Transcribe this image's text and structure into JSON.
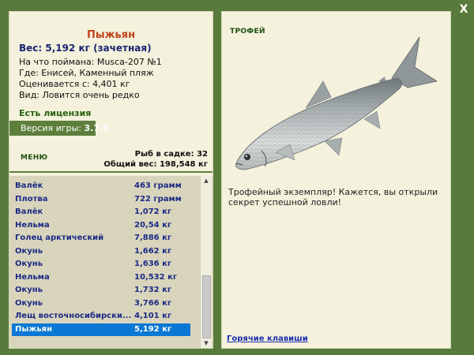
{
  "window": {
    "close_label": "X"
  },
  "fish": {
    "name": "Пыжьян",
    "weight_line": "Вес: 5,192 кг (зачетная)",
    "caught_on": "На что поймана: Musca-207 №1",
    "location": "Где: Енисей, Каменный пляж",
    "value": "Оценивается с: 4,401 кг",
    "species_note": "Вид: Ловится очень редко"
  },
  "license": "Есть лицензия",
  "version": {
    "label": "Версия игры:",
    "value": "3.7.6"
  },
  "menu_label": "МЕНЮ",
  "stats": {
    "fish_in_keepnet": "Рыб в садке: 32",
    "total_weight": "Общий вес: 198,548 кг"
  },
  "catch_list": [
    {
      "name": "Валёк",
      "weight": "463 грамм"
    },
    {
      "name": "Плотва",
      "weight": "722 грамм"
    },
    {
      "name": "Валёк",
      "weight": "1,072 кг"
    },
    {
      "name": "Нельма",
      "weight": "20,54 кг"
    },
    {
      "name": "Голец арктический",
      "weight": "7,886 кг"
    },
    {
      "name": "Окунь",
      "weight": "1,662 кг"
    },
    {
      "name": "Окунь",
      "weight": "1,636 кг"
    },
    {
      "name": "Нельма",
      "weight": "10,532 кг"
    },
    {
      "name": "Окунь",
      "weight": "1,732 кг"
    },
    {
      "name": "Окунь",
      "weight": "3,766 кг"
    },
    {
      "name": "Лещ восточносибирски...",
      "weight": "4,101 кг"
    },
    {
      "name": "Пыжьян",
      "weight": "5,192 кг"
    }
  ],
  "selected_index": 11,
  "trophy": {
    "label": "ТРОФЕЙ",
    "text": "Трофейный экземпляр! Кажется, вы открыли секрет успешной ловли!"
  },
  "hotkeys_label": "Горячие клавиши",
  "colors": {
    "frame": "#587b3b",
    "panel": "#f4f1dc",
    "list_bg": "#d9d5bc",
    "selected": "#0a78d4",
    "fish_name": "#c0441c",
    "list_text": "#1b2a86"
  },
  "icons": [
    "close-icon",
    "scroll-up-arrow-icon",
    "scroll-down-arrow-icon"
  ]
}
